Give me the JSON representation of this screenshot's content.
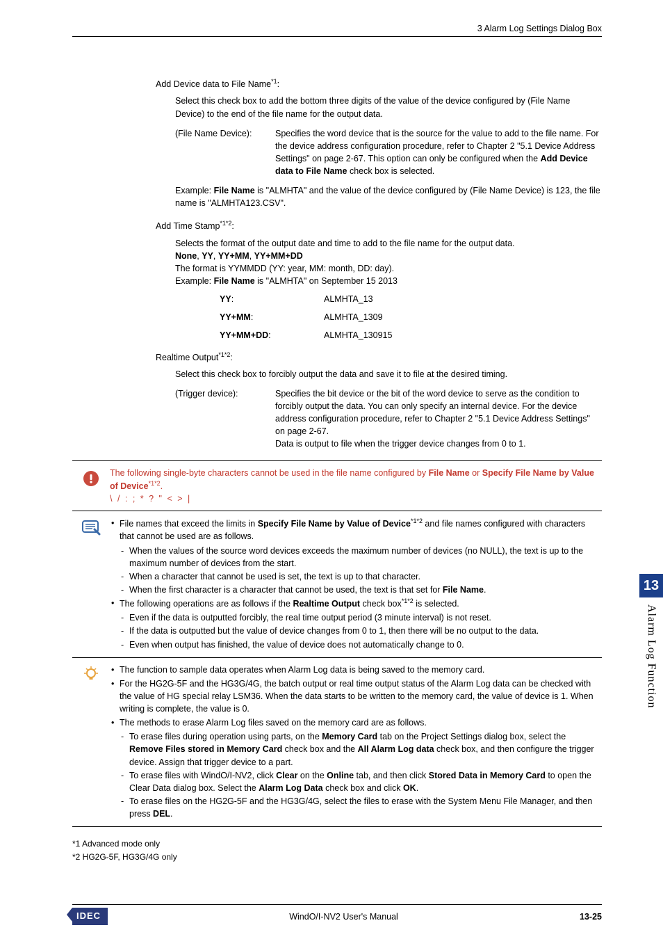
{
  "header": {
    "title": "3 Alarm Log Settings Dialog Box"
  },
  "s1": {
    "title_a": "Add Device data to File Name",
    "title_sup": "*1",
    "title_b": ":",
    "p1": "Select this check box to add the bottom three digits of the value of the device configured by (File Name Device) to the end of the file name for the output data.",
    "def_label": "(File Name Device):",
    "def_body_a": "Specifies the word device that is the source for the value to add to the file name. For the device address configuration procedure, refer to Chapter 2 \"5.1 Device Address Settings\" on page 2-67. This option can only be configured when the ",
    "def_body_b": "Add Device data to File Name",
    "def_body_c": " check box is selected.",
    "ex_a": "Example: ",
    "ex_b": "File Name",
    "ex_c": " is \"ALMHTA\" and the value of the device configured by (File Name Device) is 123, the file name is \"ALMHTA123.CSV\"."
  },
  "s2": {
    "title_a": "Add Time Stamp",
    "title_sup": "*1*2",
    "title_b": ":",
    "p1": "Selects the format of the output date and time to add to the file name for the output data.",
    "opts_a": "None",
    "opts_b": ", ",
    "opts_c": "YY",
    "opts_d": ", ",
    "opts_e": "YY+MM",
    "opts_f": ", ",
    "opts_g": "YY+MM+DD",
    "p2": "The format is YYMMDD (YY: year, MM: month, DD: day).",
    "ex_a": "Example: ",
    "ex_b": "File Name",
    "ex_c": " is \"ALMHTA\" on September 15 2013",
    "rows": [
      {
        "label": "YY",
        "colon": ":",
        "val": "ALMHTA_13"
      },
      {
        "label": "YY+MM",
        "colon": ":",
        "val": "ALMHTA_1309"
      },
      {
        "label": "YY+MM+DD",
        "colon": ":",
        "val": "ALMHTA_130915"
      }
    ]
  },
  "s3": {
    "title_a": "Realtime Output",
    "title_sup": "*1*2",
    "title_b": ":",
    "p1": "Select this check box to forcibly output the data and save it to file at the desired timing.",
    "def_label": "(Trigger device):",
    "def_body": "Specifies the bit device or the bit of the word device to serve as the condition to forcibly output the data. You can only specify an internal device. For the device address configuration procedure, refer to Chapter 2 \"5.1 Device Address Settings\" on page 2-67.",
    "def_body2": "Data is output to file when the trigger device changes from 0 to 1."
  },
  "note1": {
    "a": "The following single-byte characters cannot be used in the file name configured by ",
    "b": "File Name",
    "c": " or ",
    "d": "Specify File Name by Value of Device",
    "sup": "*1*2",
    "e": ".",
    "chars": "\\ / : ; * ? \" < > |"
  },
  "note2": {
    "l1a": "File names that exceed the limits in ",
    "l1b": "Specify File Name by Value of Device",
    "l1sup": "*1*2",
    "l1c": " and file names configured with characters that cannot be used are as follows.",
    "d1": "When the values of the source word devices exceeds the maximum number of devices (no NULL), the text is up to the maximum number of devices from the start.",
    "d2": "When a character that cannot be used is set, the text is up to that character.",
    "d3a": "When the first character is a character that cannot be used, the text is that set for ",
    "d3b": "File Name",
    "d3c": ".",
    "l2a": "The following operations are as follows if the ",
    "l2b": "Realtime Output",
    "l2c": " check box",
    "l2sup": "*1*2",
    "l2d": " is selected.",
    "d4": "Even if the data is outputted forcibly, the real time output period (3 minute interval) is not reset.",
    "d5": "If the data is outputted but the value of device changes from 0 to 1, then there will be no output to the data.",
    "d6": "Even when output has finished, the value of device does not automatically change to 0."
  },
  "note3": {
    "l1": "The function to sample data operates when Alarm Log data is being saved to the memory card.",
    "l2": "For the HG2G-5F and the HG3G/4G, the batch output or real time output status of the Alarm Log data can be checked with the value of HG special relay LSM36. When the data starts to be written to the memory card, the value of device is 1. When writing is complete, the value is 0.",
    "l3": "The methods to erase Alarm Log files saved on the memory card are as follows.",
    "d1a": "To erase files during operation using parts, on the ",
    "d1b": "Memory Card",
    "d1c": " tab on the Project Settings dialog box, select the ",
    "d1d": "Remove Files stored in Memory Card",
    "d1e": " check box and the ",
    "d1f": "All Alarm Log data",
    "d1g": " check box, and then configure the trigger device. Assign that trigger device to a part.",
    "d2a": "To erase files with WindO/I-NV2, click ",
    "d2b": "Clear",
    "d2c": " on the ",
    "d2d": "Online",
    "d2e": " tab, and then click ",
    "d2f": "Stored Data in Memory Card",
    "d2g": " to open the Clear Data dialog box. Select the ",
    "d2h": "Alarm Log Data",
    "d2i": " check box and click ",
    "d2j": "OK",
    "d2k": ".",
    "d3a": "To erase files on the HG2G-5F and the HG3G/4G, select the files to erase with the System Menu File Manager, and then press ",
    "d3b": "DEL",
    "d3c": "."
  },
  "footnotes": {
    "f1": "*1  Advanced mode only",
    "f2": "*2  HG2G-5F, HG3G/4G only"
  },
  "sidetab": {
    "num": "13",
    "text": "Alarm Log Function"
  },
  "footer": {
    "logo": "IDEC",
    "center": "WindO/I-NV2 User's Manual",
    "right": "13-25"
  }
}
